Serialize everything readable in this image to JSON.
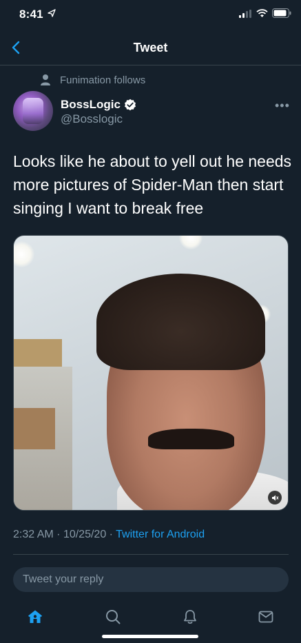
{
  "status_bar": {
    "time": "8:41"
  },
  "nav": {
    "title": "Tweet"
  },
  "social_context": {
    "text": "Funimation follows"
  },
  "author": {
    "name": "BossLogic",
    "handle": "@Bosslogic"
  },
  "tweet": {
    "text": "Looks like he about to yell out he needs more pictures of Spider-Man then start singing I want to break free",
    "time": "2:32 AM",
    "date": "10/25/20",
    "source": "Twitter for Android"
  },
  "reply": {
    "placeholder": "Tweet your reply"
  },
  "colors": {
    "background": "#15202b",
    "accent": "#1da1f2",
    "secondary_text": "#8899a6",
    "divider": "#38444d"
  }
}
